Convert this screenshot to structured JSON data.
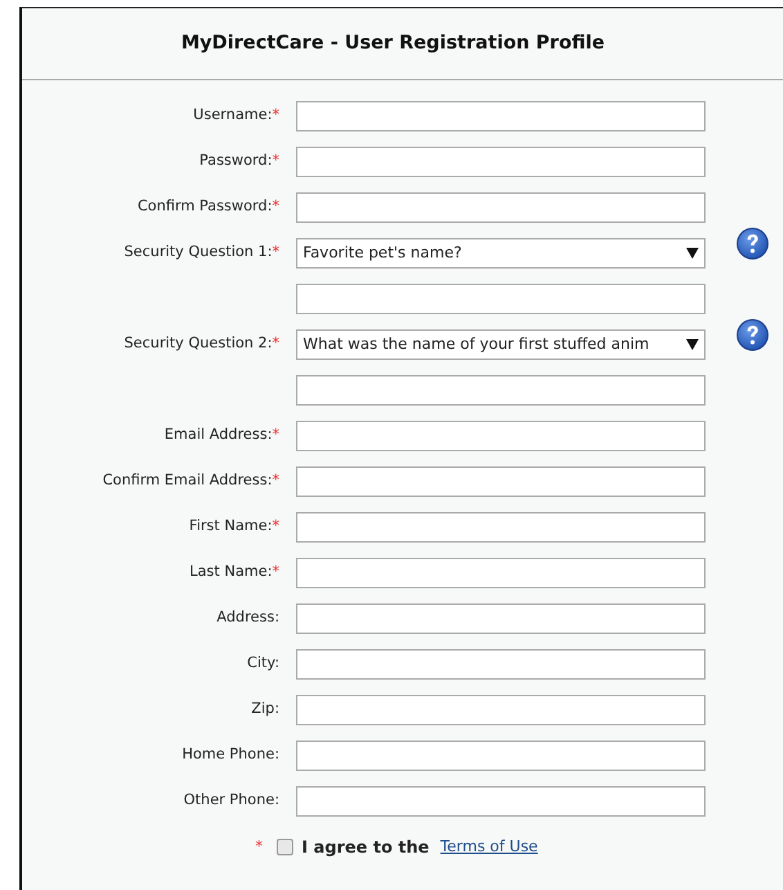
{
  "title": "MyDirectCare - User Registration Profile",
  "fields": [
    {
      "kind": "text",
      "label": "Username:",
      "required_mark": "*"
    },
    {
      "kind": "text",
      "label": "Password:",
      "required_mark": "*"
    },
    {
      "kind": "text",
      "label": "Confirm Password:",
      "required_mark": "*"
    },
    {
      "kind": "select",
      "label": "Security Question 1:",
      "required_mark": "*",
      "value": "Favorite pet's name?",
      "help": true
    },
    {
      "kind": "answer"
    },
    {
      "kind": "select",
      "label": "Security Question 2:",
      "required_mark": "*",
      "value": "What was the name of your first stuffed anim",
      "help": true
    },
    {
      "kind": "answer"
    },
    {
      "kind": "text",
      "label": "Email Address:",
      "required_mark": "*"
    },
    {
      "kind": "text",
      "label": "Confirm Email Address:",
      "required_mark": "*"
    },
    {
      "kind": "text",
      "label": "First Name:",
      "required_mark": "*"
    },
    {
      "kind": "text",
      "label": "Last Name:",
      "required_mark": "*"
    },
    {
      "kind": "text",
      "label": "Address:"
    },
    {
      "kind": "text",
      "label": "City:"
    },
    {
      "kind": "text",
      "label": "Zip:"
    },
    {
      "kind": "text",
      "label": "Home Phone:"
    },
    {
      "kind": "text",
      "label": "Other Phone:"
    }
  ],
  "agreement": {
    "required_mark": "*",
    "checked": false,
    "text": "I agree to the",
    "link": "Terms of Use"
  }
}
